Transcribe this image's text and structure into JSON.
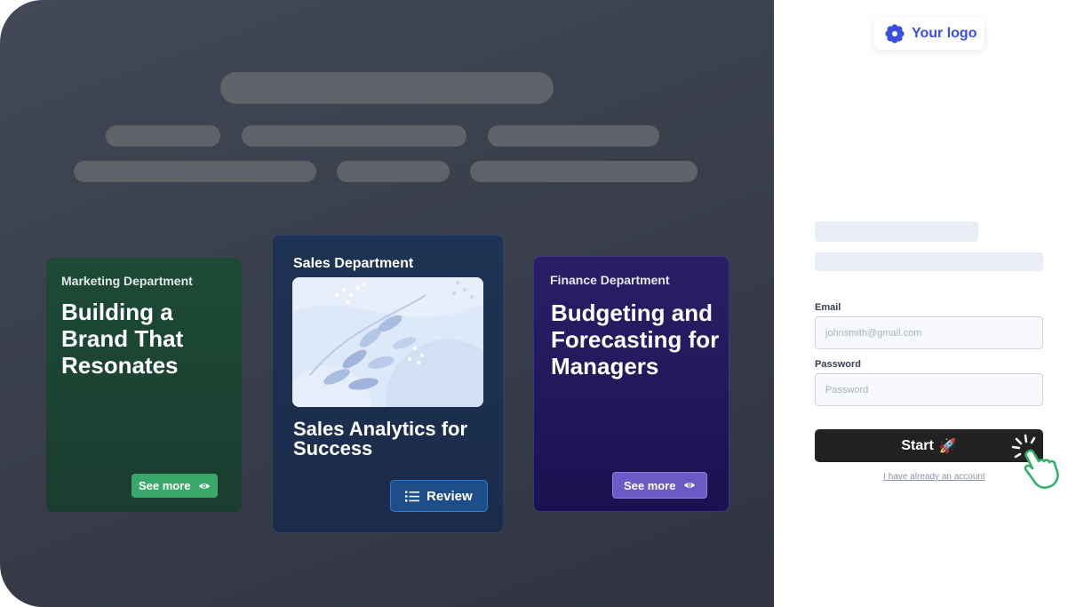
{
  "cards": {
    "marketing": {
      "department": "Marketing Department",
      "headline": "Building a Brand That Resonates",
      "button_label": "See more",
      "button_icon": "eye-icon"
    },
    "sales": {
      "department": "Sales Department",
      "headline": "Sales Analytics for Success",
      "button_label": "Review",
      "button_icon": "list-icon"
    },
    "finance": {
      "department": "Finance Department",
      "headline": "Budgeting and Forecasting for Managers",
      "button_label": "See more",
      "button_icon": "eye-icon"
    }
  },
  "logo": {
    "text": "Your logo",
    "icon": "gear-flower-icon"
  },
  "form": {
    "email_label": "Email",
    "email_placeholder": "johnsmith@gmail.com",
    "password_label": "Password",
    "password_placeholder": "Password",
    "start_label": "Start",
    "start_emoji": "🚀",
    "already_account_label": "I have already an account"
  },
  "colors": {
    "dark_panel": "#3b404c",
    "marketing_card": "#1d4a36",
    "sales_card": "#1e3253",
    "finance_card": "#2a1f66",
    "marketing_button": "#3aa86a",
    "sales_button": "#1e4e8a",
    "finance_button": "#6b5bc7",
    "logo_accent": "#3b4fe0",
    "start_button": "#222222",
    "cursor_accent": "#2fb36b"
  }
}
